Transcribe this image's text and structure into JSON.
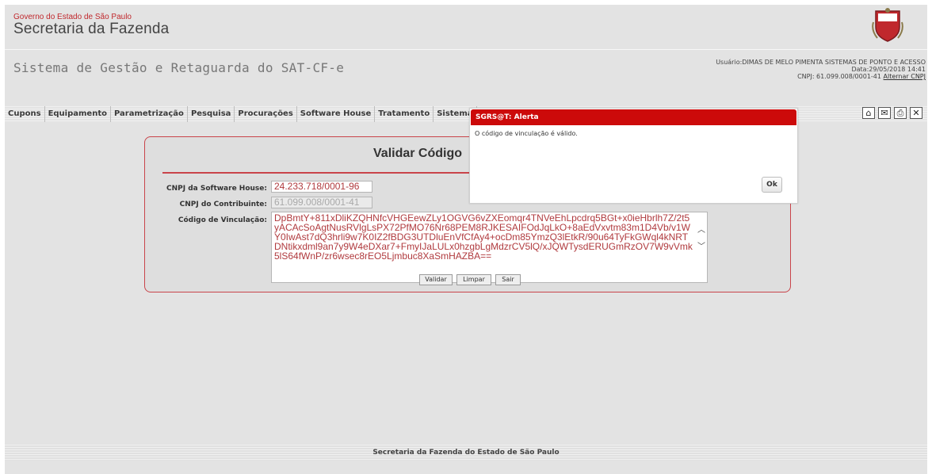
{
  "header": {
    "gov_line": "Governo do Estado de São Paulo",
    "secretaria": "Secretaria da Fazenda",
    "crest_text": "SP"
  },
  "system_title": "Sistema de Gestão e Retaguarda do SAT-CF-e",
  "user": {
    "usuario": "Usuário:DIMAS DE MELO PIMENTA SISTEMAS DE PONTO E ACESSO",
    "data": "Data:29/05/2018 14:41",
    "cnpj": "CNPJ: 61.099.008/0001-41",
    "alternar": "Alternar CNPJ"
  },
  "menu": [
    "Cupons",
    "Equipamento",
    "Parametrização",
    "Pesquisa",
    "Procurações",
    "Software House",
    "Tratamento",
    "Sistema"
  ],
  "toolbar": {
    "icons": [
      "home-icon",
      "mail-icon",
      "print-icon",
      "close-icon"
    ]
  },
  "form": {
    "title": "Validar Código",
    "software_house_label": "CNPJ da Software House:",
    "software_house_value": "24.233.718/0001-96",
    "contribuinte_label": "CNPJ do Contribuinte:",
    "contribuinte_value": "61.099.008/0001-41",
    "codigo_label": "Código de Vinculação:",
    "codigo_value": "DpBmtY+811xDliKZQHNfcVHGEewZLy1OGVG6vZXEomqr4TNVeEhLpcdrq5BGt+x0ieHbrlh7Z/2t5yACAcSoAgtNusRVlgLsPX72PfMO76Nr68PEM8RJKESAIFOdJqLkO+8aEdVxvtm83m1D4Vb/v1WY0IwAst7dQ3hrli9w7K0IZ2fBDG3UTDluEnVfCfAy4+ocDm85YmzQ3lEtkR/90u64TyFkGWql4kNRTDNtikxdml9an7y9W4eDXar7+FmyIJaLULx0hzgbLgMdzrCV5lQ/xJQWTysdERUGmRzOV7W9vVmk5lS64fWnP/zr6wsec8rEO5Ljmbuc8XaSmHAZBA==",
    "validar": "Validar",
    "limpar": "Limpar",
    "sair": "Sair"
  },
  "alert": {
    "title": "SGRS@T: Alerta",
    "message": "O código de vinculação é válido.",
    "ok": "Ok"
  },
  "footer": "Secretaria da Fazenda do Estado de São Paulo",
  "colors": {
    "accent_red": "#cc0a0a",
    "panel_border": "#c9444a"
  }
}
